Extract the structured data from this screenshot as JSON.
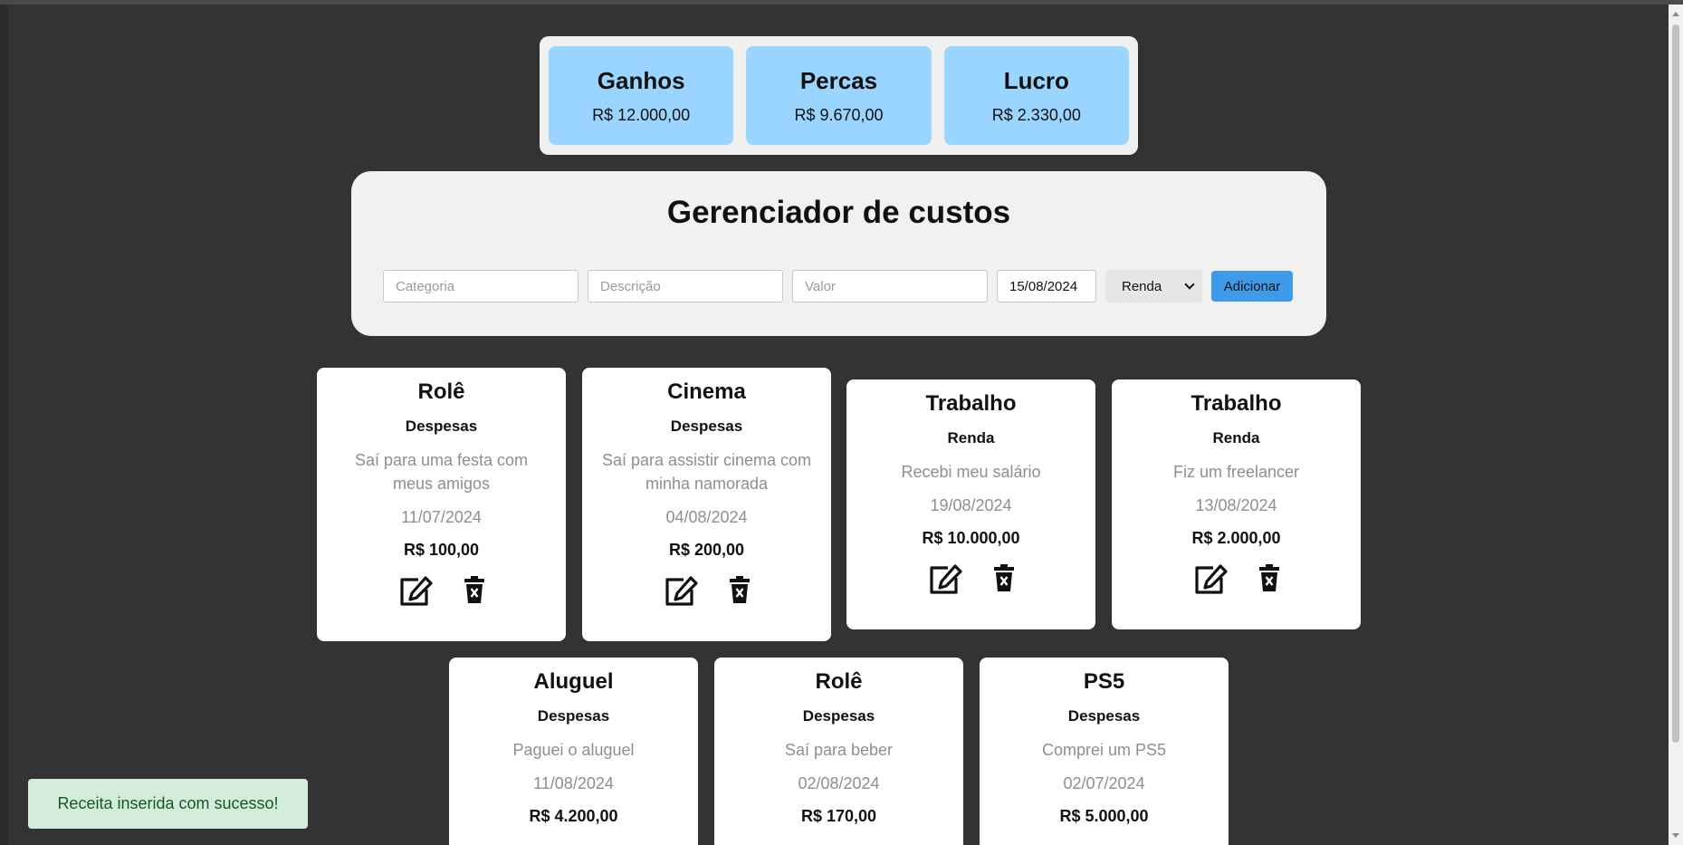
{
  "summary": {
    "ganhos": {
      "title": "Ganhos",
      "value": "R$ 12.000,00"
    },
    "percas": {
      "title": "Percas",
      "value": "R$ 9.670,00"
    },
    "lucro": {
      "title": "Lucro",
      "value": "R$ 2.330,00"
    }
  },
  "form": {
    "title": "Gerenciador de custos",
    "categoria_placeholder": "Categoria",
    "descricao_placeholder": "Descrição",
    "valor_placeholder": "Valor",
    "date_value": "15/08/2024",
    "type_selected": "Renda",
    "add_label": "Adicionar"
  },
  "cards": [
    {
      "category": "Rolê",
      "type": "Despesas",
      "description": "Saí para uma festa com meus amigos",
      "date": "11/07/2024",
      "value": "R$ 100,00"
    },
    {
      "category": "Cinema",
      "type": "Despesas",
      "description": "Saí para assistir cinema com minha namorada",
      "date": "04/08/2024",
      "value": "R$ 200,00"
    },
    {
      "category": "Trabalho",
      "type": "Renda",
      "description": "Recebi meu salário",
      "date": "19/08/2024",
      "value": "R$ 10.000,00"
    },
    {
      "category": "Trabalho",
      "type": "Renda",
      "description": "Fiz um freelancer",
      "date": "13/08/2024",
      "value": "R$ 2.000,00"
    },
    {
      "category": "Aluguel",
      "type": "Despesas",
      "description": "Paguei o aluguel",
      "date": "11/08/2024",
      "value": "R$ 4.200,00"
    },
    {
      "category": "Rolê",
      "type": "Despesas",
      "description": "Saí para beber",
      "date": "02/08/2024",
      "value": "R$ 170,00"
    },
    {
      "category": "PS5",
      "type": "Despesas",
      "description": "Comprei um PS5",
      "date": "02/07/2024",
      "value": "R$ 5.000,00"
    }
  ],
  "toast": {
    "message": "Receita inserida com sucesso!",
    "color": "#155724",
    "background": "#d4edda"
  },
  "icons": {
    "edit": "edit-icon",
    "delete": "trash-icon"
  },
  "colors": {
    "background": "#333333",
    "summary_card": "#99d5ff",
    "accent": "#3d9be9"
  }
}
